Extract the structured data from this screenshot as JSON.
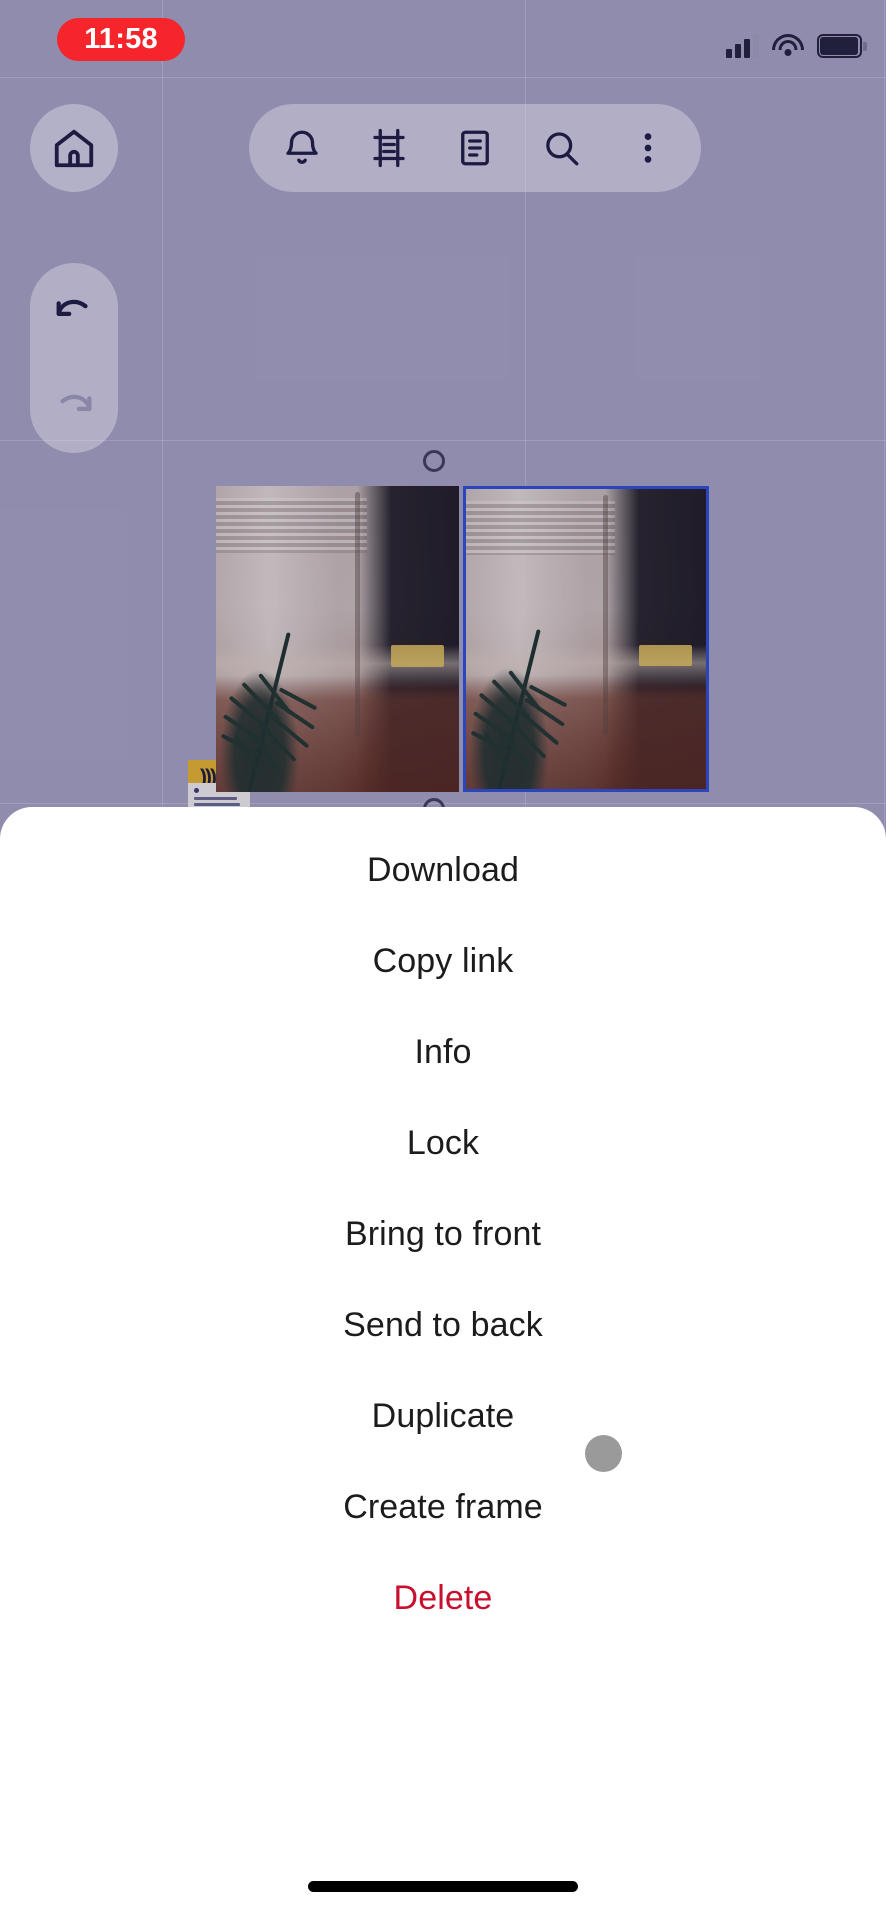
{
  "status_bar": {
    "time": "11:58",
    "time_pill_color": "#f5252b",
    "signal_icon": "cellular-signal-icon",
    "wifi_icon": "wifi-icon",
    "battery_icon": "battery-full-icon"
  },
  "toolbar": {
    "home_icon": "home-icon",
    "items": [
      {
        "icon": "bell-icon",
        "name": "notifications-button"
      },
      {
        "icon": "frame-icon",
        "name": "frame-button"
      },
      {
        "icon": "document-icon",
        "name": "notes-button"
      },
      {
        "icon": "search-icon",
        "name": "search-button"
      },
      {
        "icon": "more-vertical-icon",
        "name": "more-button"
      }
    ]
  },
  "history_controls": {
    "undo_icon": "undo-arrow-icon",
    "redo_icon": "redo-arrow-icon",
    "undo_enabled": true,
    "redo_enabled": false
  },
  "canvas": {
    "background_color": "#a8a4c5",
    "grid_visible": true,
    "selection_color": "#2d4fd6",
    "objects": [
      {
        "name": "image-jar-left",
        "type": "image",
        "selected": false
      },
      {
        "name": "image-jar-right",
        "type": "image",
        "selected": true
      },
      {
        "name": "sticky-note",
        "type": "note",
        "selected": false
      }
    ]
  },
  "context_menu": {
    "items": [
      {
        "label": "Download",
        "name": "menu-item-download",
        "danger": false
      },
      {
        "label": "Copy link",
        "name": "menu-item-copy-link",
        "danger": false
      },
      {
        "label": "Info",
        "name": "menu-item-info",
        "danger": false
      },
      {
        "label": "Lock",
        "name": "menu-item-lock",
        "danger": false
      },
      {
        "label": "Bring to front",
        "name": "menu-item-bring-to-front",
        "danger": false
      },
      {
        "label": "Send to back",
        "name": "menu-item-send-to-back",
        "danger": false
      },
      {
        "label": "Duplicate",
        "name": "menu-item-duplicate",
        "danger": false
      },
      {
        "label": "Create frame",
        "name": "menu-item-create-frame",
        "danger": false
      },
      {
        "label": "Delete",
        "name": "menu-item-delete",
        "danger": true
      }
    ],
    "danger_color": "#c8102e",
    "text_color": "#1c1c1e"
  },
  "touch_indicator": {
    "name": "touch-point-indicator",
    "color": "#9a9a9a"
  },
  "home_indicator": {
    "name": "home-indicator-bar",
    "color": "#000000"
  }
}
